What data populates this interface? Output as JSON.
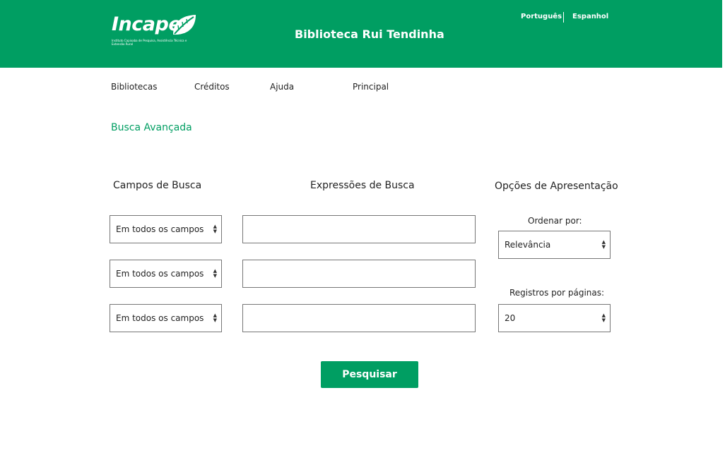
{
  "header": {
    "logo_text": "Incaper",
    "logo_subtitle": "Instituto Capixaba de Pesquisa, Assistência Técnica e Extensão Rural",
    "title": "Biblioteca Rui Tendinha",
    "languages": [
      "Português",
      "Espanhol"
    ]
  },
  "nav": {
    "items": [
      "Bibliotecas",
      "Créditos",
      "Ajuda",
      "Principal"
    ]
  },
  "page": {
    "heading": "Busca Avançada"
  },
  "search": {
    "fields_header": "Campos de Busca",
    "expressions_header": "Expressões de Busca",
    "rows": [
      {
        "field": "Em todos os campos",
        "expression": ""
      },
      {
        "field": "Em todos os campos",
        "expression": ""
      },
      {
        "field": "Em todos os campos",
        "expression": ""
      }
    ]
  },
  "options": {
    "header": "Opções de Apresentação",
    "order_label": "Ordenar por:",
    "order_value": "Relevância",
    "records_label": "Registros por páginas:",
    "records_value": "20"
  },
  "submit_label": "Pesquisar",
  "colors": {
    "brand": "#009e62"
  }
}
